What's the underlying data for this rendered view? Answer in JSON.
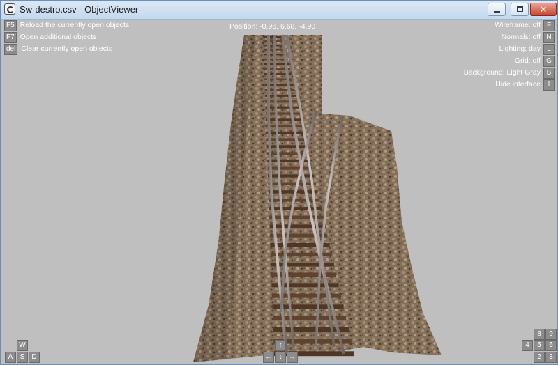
{
  "window": {
    "title": "Sw-destro.csv - ObjectViewer",
    "controls": {
      "minimize": "minimize",
      "maximize": "maximize",
      "close": "✕"
    }
  },
  "left_commands": [
    {
      "key": "F5",
      "label": "Reload the currently open objects"
    },
    {
      "key": "F7",
      "label": "Open additional objects"
    },
    {
      "key": "del",
      "label": "Clear currently open objects"
    }
  ],
  "position": "Position: -0.96, 6.68, -4.90",
  "right_options": [
    {
      "label": "Wireframe: off",
      "key": "F"
    },
    {
      "label": "Normals: off",
      "key": "N"
    },
    {
      "label": "Lighting: day",
      "key": "L"
    },
    {
      "label": "Grid: off",
      "key": "G"
    },
    {
      "label": "Background: Light Gray",
      "key": "B"
    },
    {
      "label": "Hide interface",
      "key": "I"
    }
  ],
  "camera_keys": {
    "w": "W",
    "a": "A",
    "s": "S",
    "d": "D",
    "up": "↑",
    "down": "↓",
    "left": "←",
    "right": "→",
    "n8": "8",
    "n9": "9",
    "n4": "4",
    "n5": "5",
    "n6": "6",
    "n2": "2",
    "n3": "3"
  },
  "colors": {
    "viewport_bg": "#bfbfbf",
    "ballast": "#8a7560",
    "rail": "#9e9a96",
    "sleeper": "#5a3f2c"
  }
}
